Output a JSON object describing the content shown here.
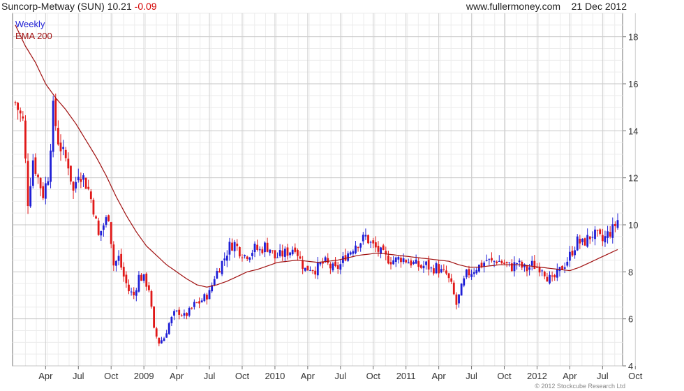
{
  "header": {
    "name": "Suncorp-Metway (SUN)",
    "price": "10.21",
    "change": "-0.09",
    "source": "www.fullermoney.com",
    "date": "21 Dec 2012"
  },
  "legend": {
    "period": "Weekly",
    "ema": "EMA 200"
  },
  "credit": "© 2012 Stockcube Research Ltd",
  "colors": {
    "up": "#1f1fd6",
    "down": "#e01818",
    "ema": "#a01010",
    "grid": "#dcdcdc",
    "frame": "#707070"
  },
  "chart_data": {
    "type": "candlestick",
    "title": "Suncorp-Metway (SUN) 10.21 -0.09",
    "ylim": [
      4,
      19
    ],
    "y_ticks": [
      4,
      6,
      8,
      10,
      12,
      14,
      16,
      18
    ],
    "x_tick_labels": [
      "Apr",
      "Jul",
      "Oct",
      "2009",
      "Apr",
      "Jul",
      "Oct",
      "2010",
      "Apr",
      "Jul",
      "Oct",
      "2011",
      "Apr",
      "Jul",
      "Oct",
      "2012",
      "Apr",
      "Jul",
      "Oct"
    ],
    "x_tick_weeks": [
      12,
      25,
      38,
      51,
      64,
      77,
      90,
      103,
      116,
      129,
      142,
      155,
      168,
      181,
      194,
      207,
      220,
      233,
      246
    ],
    "close_path": [
      [
        0,
        15.2
      ],
      [
        3,
        14.4
      ],
      [
        5,
        11
      ],
      [
        7,
        12.8
      ],
      [
        9,
        12
      ],
      [
        11,
        11.3
      ],
      [
        13,
        12.1
      ],
      [
        15,
        14.9
      ],
      [
        17,
        13.6
      ],
      [
        19,
        13
      ],
      [
        21,
        12.6
      ],
      [
        23,
        11.4
      ],
      [
        25,
        12.3
      ],
      [
        27,
        12
      ],
      [
        29,
        11.5
      ],
      [
        31,
        10.7
      ],
      [
        33,
        9.5
      ],
      [
        35,
        10
      ],
      [
        37,
        10.4
      ],
      [
        39,
        8.3
      ],
      [
        41,
        8.6
      ],
      [
        43,
        7.8
      ],
      [
        45,
        7.2
      ],
      [
        47,
        7
      ],
      [
        49,
        7.8
      ],
      [
        51,
        7.7
      ],
      [
        53,
        7.3
      ],
      [
        55,
        5.5
      ],
      [
        57,
        5
      ],
      [
        59,
        5.2
      ],
      [
        61,
        5.8
      ],
      [
        63,
        6.2
      ],
      [
        65,
        6.3
      ],
      [
        67,
        6.1
      ],
      [
        69,
        6.3
      ],
      [
        71,
        6.6
      ],
      [
        73,
        6.7
      ],
      [
        75,
        6.9
      ],
      [
        77,
        7.1
      ],
      [
        79,
        7.8
      ],
      [
        81,
        8.2
      ],
      [
        83,
        8.6
      ],
      [
        85,
        9.1
      ],
      [
        87,
        9.2
      ],
      [
        89,
        8.9
      ],
      [
        91,
        8.7
      ],
      [
        93,
        8.8
      ],
      [
        95,
        9
      ],
      [
        97,
        8.9
      ],
      [
        99,
        9.1
      ],
      [
        101,
        9
      ],
      [
        103,
        8.6
      ],
      [
        105,
        8.7
      ],
      [
        107,
        8.8
      ],
      [
        109,
        8.9
      ],
      [
        111,
        9.1
      ],
      [
        113,
        8.5
      ],
      [
        115,
        8.1
      ],
      [
        117,
        8.2
      ],
      [
        119,
        8.1
      ],
      [
        121,
        8.3
      ],
      [
        123,
        8.4
      ],
      [
        125,
        8.2
      ],
      [
        127,
        8.1
      ],
      [
        129,
        8.3
      ],
      [
        131,
        8.7
      ],
      [
        133,
        8.9
      ],
      [
        135,
        9.2
      ],
      [
        137,
        9.3
      ],
      [
        139,
        9.5
      ],
      [
        141,
        9.2
      ],
      [
        143,
        9
      ],
      [
        145,
        8.8
      ],
      [
        147,
        8.6
      ],
      [
        149,
        8.5
      ],
      [
        151,
        8.5
      ],
      [
        153,
        8.6
      ],
      [
        155,
        8.5
      ],
      [
        157,
        8.4
      ],
      [
        159,
        8.3
      ],
      [
        161,
        8.2
      ],
      [
        163,
        8.3
      ],
      [
        165,
        8.1
      ],
      [
        167,
        8.2
      ],
      [
        169,
        8.0
      ],
      [
        171,
        7.9
      ],
      [
        173,
        7.4
      ],
      [
        175,
        6.6
      ],
      [
        177,
        7.3
      ],
      [
        179,
        7.9
      ],
      [
        181,
        8.0
      ],
      [
        183,
        8.2
      ],
      [
        185,
        8.3
      ],
      [
        187,
        8.5
      ],
      [
        189,
        8.4
      ],
      [
        191,
        8.5
      ],
      [
        193,
        8.4
      ],
      [
        195,
        8.3
      ],
      [
        197,
        8.2
      ],
      [
        199,
        8.4
      ],
      [
        201,
        8.2
      ],
      [
        203,
        8.1
      ],
      [
        205,
        8.3
      ],
      [
        207,
        8.2
      ],
      [
        209,
        8.2
      ],
      [
        211,
        7.8
      ],
      [
        213,
        7.6
      ],
      [
        215,
        7.9
      ],
      [
        217,
        8.2
      ],
      [
        219,
        8.5
      ],
      [
        221,
        8.9
      ],
      [
        223,
        9.3
      ],
      [
        225,
        9.2
      ],
      [
        227,
        9.4
      ],
      [
        229,
        9.6
      ],
      [
        231,
        9.5
      ],
      [
        233,
        9.3
      ],
      [
        235,
        9.6
      ],
      [
        237,
        9.8
      ],
      [
        239,
        10.2
      ]
    ],
    "ema_path": [
      [
        0,
        18.5
      ],
      [
        4,
        17.6
      ],
      [
        8,
        16.9
      ],
      [
        12,
        16.0
      ],
      [
        16,
        15.4
      ],
      [
        20,
        14.9
      ],
      [
        24,
        14.3
      ],
      [
        28,
        13.6
      ],
      [
        32,
        12.9
      ],
      [
        36,
        12.1
      ],
      [
        40,
        11.2
      ],
      [
        44,
        10.4
      ],
      [
        48,
        9.7
      ],
      [
        52,
        9.1
      ],
      [
        56,
        8.7
      ],
      [
        60,
        8.3
      ],
      [
        64,
        8.0
      ],
      [
        68,
        7.7
      ],
      [
        72,
        7.45
      ],
      [
        76,
        7.35
      ],
      [
        80,
        7.45
      ],
      [
        84,
        7.6
      ],
      [
        88,
        7.8
      ],
      [
        92,
        8.0
      ],
      [
        96,
        8.1
      ],
      [
        100,
        8.25
      ],
      [
        104,
        8.4
      ],
      [
        108,
        8.45
      ],
      [
        112,
        8.5
      ],
      [
        116,
        8.45
      ],
      [
        120,
        8.4
      ],
      [
        124,
        8.45
      ],
      [
        128,
        8.5
      ],
      [
        132,
        8.6
      ],
      [
        136,
        8.7
      ],
      [
        140,
        8.75
      ],
      [
        144,
        8.8
      ],
      [
        148,
        8.75
      ],
      [
        152,
        8.7
      ],
      [
        156,
        8.65
      ],
      [
        160,
        8.6
      ],
      [
        164,
        8.55
      ],
      [
        168,
        8.5
      ],
      [
        172,
        8.45
      ],
      [
        176,
        8.3
      ],
      [
        180,
        8.2
      ],
      [
        184,
        8.2
      ],
      [
        188,
        8.25
      ],
      [
        192,
        8.3
      ],
      [
        196,
        8.3
      ],
      [
        200,
        8.3
      ],
      [
        204,
        8.25
      ],
      [
        208,
        8.2
      ],
      [
        212,
        8.15
      ],
      [
        216,
        8.1
      ],
      [
        220,
        8.05
      ],
      [
        224,
        8.2
      ],
      [
        228,
        8.4
      ],
      [
        232,
        8.6
      ],
      [
        236,
        8.8
      ],
      [
        239,
        8.95
      ]
    ],
    "xlabel": "",
    "ylabel": ""
  }
}
